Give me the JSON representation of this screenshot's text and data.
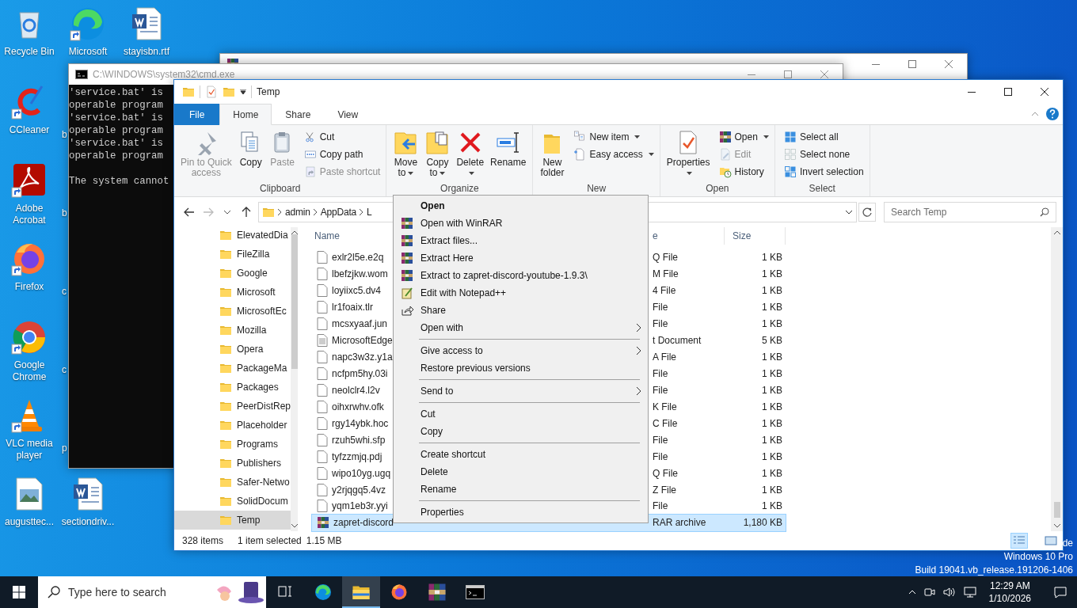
{
  "desktop": {
    "icons": [
      {
        "label": "Recycle Bin",
        "kind": "recycle",
        "shortcut": false
      },
      {
        "label": "CCleaner",
        "kind": "ccleaner",
        "shortcut": true
      },
      {
        "label": "Adobe Acrobat",
        "kind": "acrobat",
        "shortcut": true
      },
      {
        "label": "Firefox",
        "kind": "firefox",
        "shortcut": true
      },
      {
        "label": "Google Chrome",
        "kind": "chrome",
        "shortcut": true
      },
      {
        "label": "VLC media player",
        "kind": "vlc",
        "shortcut": true
      },
      {
        "label": "augusttec...",
        "kind": "image",
        "shortcut": false
      },
      {
        "label": "Microsoft",
        "kind": "edge",
        "shortcut": true
      },
      {
        "label": "b",
        "kind": "cut"
      },
      {
        "label": "b",
        "kind": "cut"
      },
      {
        "label": "c",
        "kind": "cut"
      },
      {
        "label": "c",
        "kind": "cut"
      },
      {
        "label": "p",
        "kind": "cut"
      },
      {
        "label": "sectiondriv...",
        "kind": "word",
        "shortcut": false
      },
      {
        "label": "stayisbn.rtf",
        "kind": "word",
        "shortcut": false
      }
    ]
  },
  "background_window": {
    "kind": "winrar"
  },
  "cmd_window": {
    "title": "C:\\WINDOWS\\system32\\cmd.exe",
    "blocks": [
      [
        "'service.bat' is",
        "operable program",
        "'service.bat' is",
        "operable program",
        "'service.bat' is",
        "operable program"
      ],
      [
        "The system cannot"
      ]
    ]
  },
  "explorer": {
    "title": "Temp",
    "ribbon_tabs": [
      {
        "label": "File",
        "kind": "file",
        "selected": false
      },
      {
        "label": "Home",
        "kind": "tab",
        "selected": true
      },
      {
        "label": "Share",
        "kind": "tab",
        "selected": false
      },
      {
        "label": "View",
        "kind": "tab",
        "selected": false
      }
    ],
    "ribbon_groups": [
      {
        "label": "Clipboard",
        "large": [
          {
            "lines": [
              "Pin to Quick",
              "access"
            ],
            "kind": "pin",
            "disabled": true,
            "dropdown": false
          },
          {
            "lines": [
              "Copy"
            ],
            "kind": "copy",
            "disabled": false,
            "dropdown": false
          },
          {
            "lines": [
              "Paste"
            ],
            "kind": "paste",
            "disabled": true,
            "dropdown": false
          }
        ],
        "small": [
          {
            "label": "Cut",
            "kind": "cut",
            "disabled": false,
            "dropdown": false
          },
          {
            "label": "Copy path",
            "kind": "copypath",
            "disabled": false,
            "dropdown": false
          },
          {
            "label": "Paste shortcut",
            "kind": "pasteshortcut",
            "disabled": true,
            "dropdown": false
          }
        ]
      },
      {
        "label": "Organize",
        "large": [
          {
            "lines": [
              "Move",
              "to"
            ],
            "kind": "move",
            "disabled": false,
            "dropdown": true
          },
          {
            "lines": [
              "Copy",
              "to"
            ],
            "kind": "copyto",
            "disabled": false,
            "dropdown": true
          },
          {
            "lines": [
              "Delete"
            ],
            "kind": "delete",
            "disabled": false,
            "dropdown": true
          },
          {
            "lines": [
              "Rename"
            ],
            "kind": "rename",
            "disabled": false,
            "dropdown": false
          }
        ]
      },
      {
        "label": "New",
        "large": [
          {
            "lines": [
              "New",
              "folder"
            ],
            "kind": "newfolder",
            "disabled": false,
            "dropdown": false
          }
        ],
        "small": [
          {
            "label": "New item",
            "kind": "newitem",
            "disabled": false,
            "dropdown": true
          },
          {
            "label": "Easy access",
            "kind": "easyaccess",
            "disabled": false,
            "dropdown": true
          }
        ]
      },
      {
        "label": "Open",
        "large": [
          {
            "lines": [
              "Properties"
            ],
            "kind": "properties",
            "disabled": false,
            "dropdown": true
          }
        ],
        "small": [
          {
            "label": "Open",
            "kind": "winrar",
            "disabled": false,
            "dropdown": true
          },
          {
            "label": "Edit",
            "kind": "edit",
            "disabled": true,
            "dropdown": false
          },
          {
            "label": "History",
            "kind": "history",
            "disabled": false,
            "dropdown": false
          }
        ]
      },
      {
        "label": "Select",
        "small": [
          {
            "label": "Select all",
            "kind": "selectall",
            "disabled": false,
            "dropdown": false
          },
          {
            "label": "Select none",
            "kind": "selectnone",
            "disabled": false,
            "dropdown": false
          },
          {
            "label": "Invert selection",
            "kind": "invert",
            "disabled": false,
            "dropdown": false
          }
        ]
      }
    ],
    "breadcrumb": [
      "admin",
      "AppData",
      "L"
    ],
    "search": {
      "placeholder": "Search Temp"
    },
    "nav": [
      {
        "label": "ElevatedDia",
        "selected": false
      },
      {
        "label": "FileZilla",
        "selected": false
      },
      {
        "label": "Google",
        "selected": false
      },
      {
        "label": "Microsoft",
        "selected": false
      },
      {
        "label": "MicrosoftEc",
        "selected": false
      },
      {
        "label": "Mozilla",
        "selected": false
      },
      {
        "label": "Opera",
        "selected": false
      },
      {
        "label": "PackageMa",
        "selected": false
      },
      {
        "label": "Packages",
        "selected": false
      },
      {
        "label": "PeerDistRep",
        "selected": false
      },
      {
        "label": "Placeholder",
        "selected": false
      },
      {
        "label": "Programs",
        "selected": false
      },
      {
        "label": "Publishers",
        "selected": false
      },
      {
        "label": "Safer-Netwo",
        "selected": false
      },
      {
        "label": "SolidDocum",
        "selected": false
      },
      {
        "label": "Temp",
        "selected": true
      }
    ],
    "columns": [
      {
        "label": "Name"
      },
      {
        "label": "e"
      },
      {
        "label": "Size"
      }
    ],
    "rows": [
      {
        "name": "exlr2l5e.e2q",
        "type": "Q File",
        "size": "1 KB",
        "kind": "file",
        "selected": false
      },
      {
        "name": "lbefzjkw.wom",
        "type": "M File",
        "size": "1 KB",
        "kind": "file",
        "selected": false
      },
      {
        "name": "loyiixc5.dv4",
        "type": "4 File",
        "size": "1 KB",
        "kind": "file",
        "selected": false
      },
      {
        "name": "lr1foaix.tlr",
        "type": "File",
        "size": "1 KB",
        "kind": "file",
        "selected": false
      },
      {
        "name": "mcsxyaaf.jun",
        "type": "File",
        "size": "1 KB",
        "kind": "file",
        "selected": false
      },
      {
        "name": "MicrosoftEdge",
        "type": "t Document",
        "size": "5 KB",
        "kind": "text",
        "selected": false
      },
      {
        "name": "napc3w3z.y1a",
        "type": "A File",
        "size": "1 KB",
        "kind": "file",
        "selected": false
      },
      {
        "name": "ncfpm5hy.03i",
        "type": "File",
        "size": "1 KB",
        "kind": "file",
        "selected": false
      },
      {
        "name": "neolclr4.l2v",
        "type": "File",
        "size": "1 KB",
        "kind": "file",
        "selected": false
      },
      {
        "name": "oihxrwhv.ofk",
        "type": "K File",
        "size": "1 KB",
        "kind": "file",
        "selected": false
      },
      {
        "name": "rgy14ybk.hoc",
        "type": "C File",
        "size": "1 KB",
        "kind": "file",
        "selected": false
      },
      {
        "name": "rzuh5whi.sfp",
        "type": "File",
        "size": "1 KB",
        "kind": "file",
        "selected": false
      },
      {
        "name": "tyfzzmjq.pdj",
        "type": "File",
        "size": "1 KB",
        "kind": "file",
        "selected": false
      },
      {
        "name": "wipo10yg.ugq",
        "type": "Q File",
        "size": "1 KB",
        "kind": "file",
        "selected": false
      },
      {
        "name": "y2rjqgq5.4vz",
        "type": "Z File",
        "size": "1 KB",
        "kind": "file",
        "selected": false
      },
      {
        "name": "yqm1eb3r.yyi",
        "type": "File",
        "size": "1 KB",
        "kind": "file",
        "selected": false
      },
      {
        "name": "zapret-discord",
        "type": "RAR archive",
        "size": "1,180 KB",
        "kind": "winrar",
        "selected": true
      }
    ],
    "status": {
      "count": "328 items",
      "selection": "1 item selected",
      "size": "1.15 MB"
    },
    "views": [
      {
        "kind": "details",
        "selected": true
      },
      {
        "kind": "large",
        "selected": false
      }
    ]
  },
  "context_menu": {
    "sections": [
      [
        {
          "label": "Open",
          "default": true
        },
        {
          "label": "Open with WinRAR",
          "kind": "winrar"
        },
        {
          "label": "Extract files...",
          "kind": "winrar"
        },
        {
          "label": "Extract Here",
          "kind": "winrar"
        },
        {
          "label": "Extract to zapret-discord-youtube-1.9.3\\",
          "kind": "winrar"
        },
        {
          "label": "Edit with Notepad++",
          "kind": "notepad"
        },
        {
          "label": "Share",
          "kind": "share"
        },
        {
          "label": "Open with",
          "submenu": true
        }
      ],
      [
        {
          "label": "Give access to",
          "submenu": true
        },
        {
          "label": "Restore previous versions"
        }
      ],
      [
        {
          "label": "Send to",
          "submenu": true
        }
      ],
      [
        {
          "label": "Cut"
        },
        {
          "label": "Copy"
        }
      ],
      [
        {
          "label": "Create shortcut"
        },
        {
          "label": "Delete"
        },
        {
          "label": "Rename"
        }
      ],
      [
        {
          "label": "Properties"
        }
      ]
    ]
  },
  "watermark": {
    "cut": "de",
    "edition": "Windows 10 Pro",
    "build": "Build 19041.vb_release.191206-1406"
  },
  "taskbar": {
    "search": {
      "placeholder": "Type here to search"
    },
    "apps": [
      {
        "kind": "edge",
        "selected": false
      },
      {
        "kind": "explorer",
        "selected": true
      },
      {
        "kind": "firefox",
        "selected": false
      },
      {
        "kind": "winrar",
        "selected": false
      },
      {
        "kind": "cmd",
        "selected": false
      }
    ],
    "time": "12:29 AM",
    "date": "1/10/2026"
  }
}
